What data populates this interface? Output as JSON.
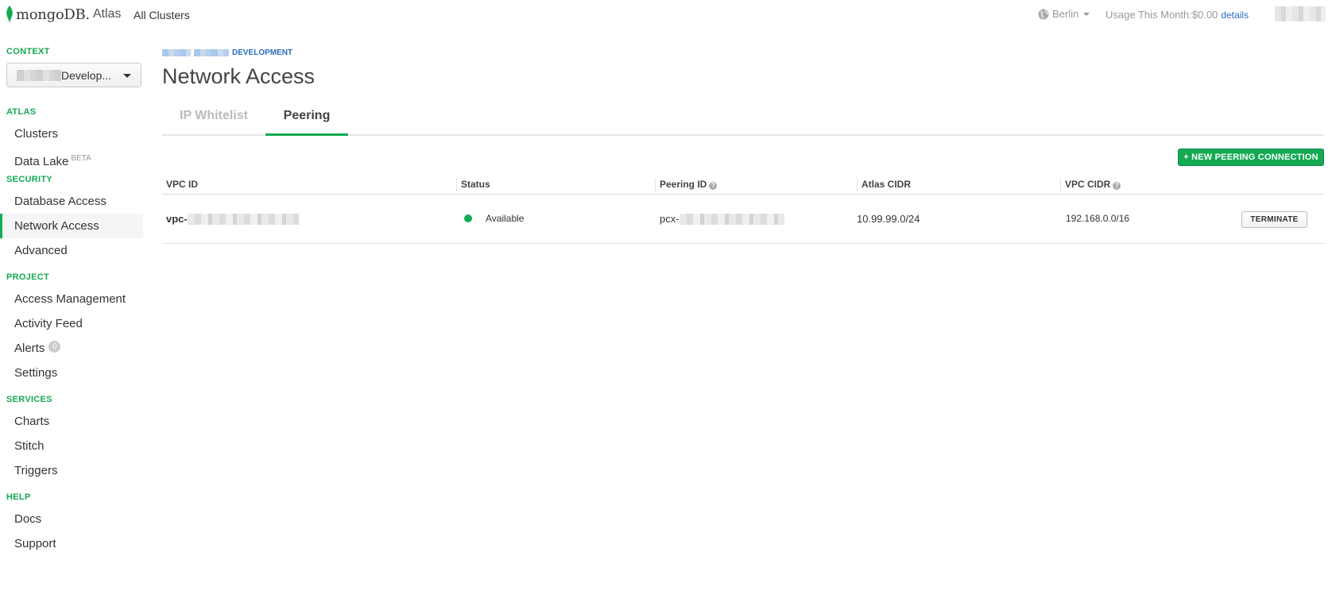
{
  "app": {
    "logo_text": "mongoDB.",
    "logo_product": "Atlas",
    "all_clusters": "All Clusters"
  },
  "header": {
    "region": "Berlin",
    "usage_label": "Usage This Month:$0.00",
    "details_link": "details"
  },
  "sidebar": {
    "context_label": "CONTEXT",
    "context_value": "Develop...",
    "sections": {
      "atlas": "ATLAS",
      "security": "SECURITY",
      "project": "PROJECT",
      "services": "SERVICES",
      "help": "HELP"
    },
    "items": {
      "clusters": "Clusters",
      "data_lake": "Data Lake",
      "data_lake_badge": "BETA",
      "database_access": "Database Access",
      "network_access": "Network Access",
      "advanced": "Advanced",
      "access_management": "Access Management",
      "activity_feed": "Activity Feed",
      "alerts": "Alerts",
      "alerts_count": "0",
      "settings": "Settings",
      "charts": "Charts",
      "stitch": "Stitch",
      "triggers": "Triggers",
      "docs": "Docs",
      "support": "Support"
    },
    "active_item": "Network Access"
  },
  "main": {
    "breadcrumb_suffix": "DEVELOPMENT",
    "title": "Network Access",
    "tabs": [
      {
        "label": "IP Whitelist",
        "active": false
      },
      {
        "label": "Peering",
        "active": true
      }
    ],
    "new_button": "+ NEW PEERING CONNECTION",
    "table": {
      "headers": [
        "VPC ID",
        "Status",
        "Peering ID",
        "Atlas CIDR",
        "VPC CIDR"
      ],
      "row": {
        "vpc_prefix": "vpc-",
        "status": "Available",
        "peering_prefix": "pcx-",
        "atlas_cidr": "10.99.99.0/24",
        "vpc_cidr": "192.168.0.0/16",
        "action": "TERMINATE"
      }
    }
  },
  "colors": {
    "accent_green": "#13aa52",
    "link_blue": "#2a6ebb"
  }
}
